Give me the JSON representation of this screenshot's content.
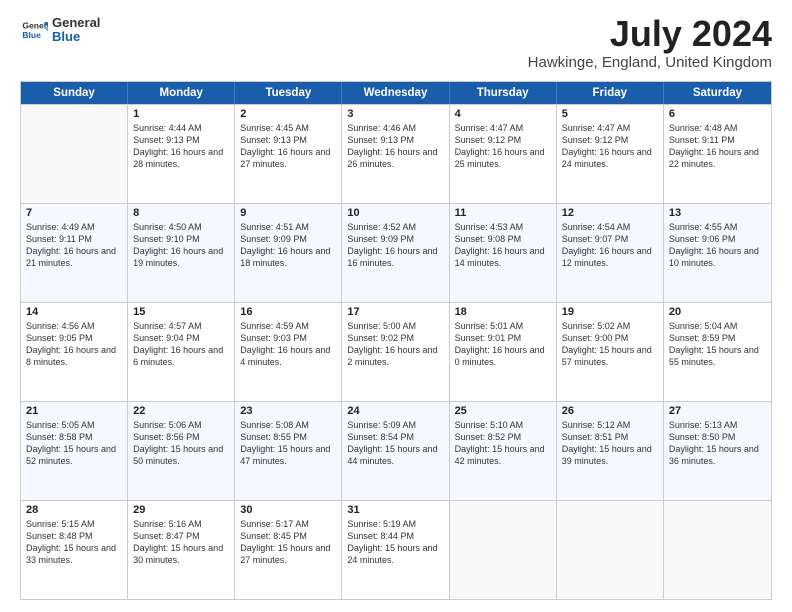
{
  "header": {
    "logo_general": "General",
    "logo_blue": "Blue",
    "title": "July 2024",
    "location": "Hawkinge, England, United Kingdom"
  },
  "days_of_week": [
    "Sunday",
    "Monday",
    "Tuesday",
    "Wednesday",
    "Thursday",
    "Friday",
    "Saturday"
  ],
  "weeks": [
    [
      {
        "day": "",
        "sunrise": "",
        "sunset": "",
        "daylight": ""
      },
      {
        "day": "1",
        "sunrise": "Sunrise: 4:44 AM",
        "sunset": "Sunset: 9:13 PM",
        "daylight": "Daylight: 16 hours and 28 minutes."
      },
      {
        "day": "2",
        "sunrise": "Sunrise: 4:45 AM",
        "sunset": "Sunset: 9:13 PM",
        "daylight": "Daylight: 16 hours and 27 minutes."
      },
      {
        "day": "3",
        "sunrise": "Sunrise: 4:46 AM",
        "sunset": "Sunset: 9:13 PM",
        "daylight": "Daylight: 16 hours and 26 minutes."
      },
      {
        "day": "4",
        "sunrise": "Sunrise: 4:47 AM",
        "sunset": "Sunset: 9:12 PM",
        "daylight": "Daylight: 16 hours and 25 minutes."
      },
      {
        "day": "5",
        "sunrise": "Sunrise: 4:47 AM",
        "sunset": "Sunset: 9:12 PM",
        "daylight": "Daylight: 16 hours and 24 minutes."
      },
      {
        "day": "6",
        "sunrise": "Sunrise: 4:48 AM",
        "sunset": "Sunset: 9:11 PM",
        "daylight": "Daylight: 16 hours and 22 minutes."
      }
    ],
    [
      {
        "day": "7",
        "sunrise": "Sunrise: 4:49 AM",
        "sunset": "Sunset: 9:11 PM",
        "daylight": "Daylight: 16 hours and 21 minutes."
      },
      {
        "day": "8",
        "sunrise": "Sunrise: 4:50 AM",
        "sunset": "Sunset: 9:10 PM",
        "daylight": "Daylight: 16 hours and 19 minutes."
      },
      {
        "day": "9",
        "sunrise": "Sunrise: 4:51 AM",
        "sunset": "Sunset: 9:09 PM",
        "daylight": "Daylight: 16 hours and 18 minutes."
      },
      {
        "day": "10",
        "sunrise": "Sunrise: 4:52 AM",
        "sunset": "Sunset: 9:09 PM",
        "daylight": "Daylight: 16 hours and 16 minutes."
      },
      {
        "day": "11",
        "sunrise": "Sunrise: 4:53 AM",
        "sunset": "Sunset: 9:08 PM",
        "daylight": "Daylight: 16 hours and 14 minutes."
      },
      {
        "day": "12",
        "sunrise": "Sunrise: 4:54 AM",
        "sunset": "Sunset: 9:07 PM",
        "daylight": "Daylight: 16 hours and 12 minutes."
      },
      {
        "day": "13",
        "sunrise": "Sunrise: 4:55 AM",
        "sunset": "Sunset: 9:06 PM",
        "daylight": "Daylight: 16 hours and 10 minutes."
      }
    ],
    [
      {
        "day": "14",
        "sunrise": "Sunrise: 4:56 AM",
        "sunset": "Sunset: 9:05 PM",
        "daylight": "Daylight: 16 hours and 8 minutes."
      },
      {
        "day": "15",
        "sunrise": "Sunrise: 4:57 AM",
        "sunset": "Sunset: 9:04 PM",
        "daylight": "Daylight: 16 hours and 6 minutes."
      },
      {
        "day": "16",
        "sunrise": "Sunrise: 4:59 AM",
        "sunset": "Sunset: 9:03 PM",
        "daylight": "Daylight: 16 hours and 4 minutes."
      },
      {
        "day": "17",
        "sunrise": "Sunrise: 5:00 AM",
        "sunset": "Sunset: 9:02 PM",
        "daylight": "Daylight: 16 hours and 2 minutes."
      },
      {
        "day": "18",
        "sunrise": "Sunrise: 5:01 AM",
        "sunset": "Sunset: 9:01 PM",
        "daylight": "Daylight: 16 hours and 0 minutes."
      },
      {
        "day": "19",
        "sunrise": "Sunrise: 5:02 AM",
        "sunset": "Sunset: 9:00 PM",
        "daylight": "Daylight: 15 hours and 57 minutes."
      },
      {
        "day": "20",
        "sunrise": "Sunrise: 5:04 AM",
        "sunset": "Sunset: 8:59 PM",
        "daylight": "Daylight: 15 hours and 55 minutes."
      }
    ],
    [
      {
        "day": "21",
        "sunrise": "Sunrise: 5:05 AM",
        "sunset": "Sunset: 8:58 PM",
        "daylight": "Daylight: 15 hours and 52 minutes."
      },
      {
        "day": "22",
        "sunrise": "Sunrise: 5:06 AM",
        "sunset": "Sunset: 8:56 PM",
        "daylight": "Daylight: 15 hours and 50 minutes."
      },
      {
        "day": "23",
        "sunrise": "Sunrise: 5:08 AM",
        "sunset": "Sunset: 8:55 PM",
        "daylight": "Daylight: 15 hours and 47 minutes."
      },
      {
        "day": "24",
        "sunrise": "Sunrise: 5:09 AM",
        "sunset": "Sunset: 8:54 PM",
        "daylight": "Daylight: 15 hours and 44 minutes."
      },
      {
        "day": "25",
        "sunrise": "Sunrise: 5:10 AM",
        "sunset": "Sunset: 8:52 PM",
        "daylight": "Daylight: 15 hours and 42 minutes."
      },
      {
        "day": "26",
        "sunrise": "Sunrise: 5:12 AM",
        "sunset": "Sunset: 8:51 PM",
        "daylight": "Daylight: 15 hours and 39 minutes."
      },
      {
        "day": "27",
        "sunrise": "Sunrise: 5:13 AM",
        "sunset": "Sunset: 8:50 PM",
        "daylight": "Daylight: 15 hours and 36 minutes."
      }
    ],
    [
      {
        "day": "28",
        "sunrise": "Sunrise: 5:15 AM",
        "sunset": "Sunset: 8:48 PM",
        "daylight": "Daylight: 15 hours and 33 minutes."
      },
      {
        "day": "29",
        "sunrise": "Sunrise: 5:16 AM",
        "sunset": "Sunset: 8:47 PM",
        "daylight": "Daylight: 15 hours and 30 minutes."
      },
      {
        "day": "30",
        "sunrise": "Sunrise: 5:17 AM",
        "sunset": "Sunset: 8:45 PM",
        "daylight": "Daylight: 15 hours and 27 minutes."
      },
      {
        "day": "31",
        "sunrise": "Sunrise: 5:19 AM",
        "sunset": "Sunset: 8:44 PM",
        "daylight": "Daylight: 15 hours and 24 minutes."
      },
      {
        "day": "",
        "sunrise": "",
        "sunset": "",
        "daylight": ""
      },
      {
        "day": "",
        "sunrise": "",
        "sunset": "",
        "daylight": ""
      },
      {
        "day": "",
        "sunrise": "",
        "sunset": "",
        "daylight": ""
      }
    ]
  ]
}
